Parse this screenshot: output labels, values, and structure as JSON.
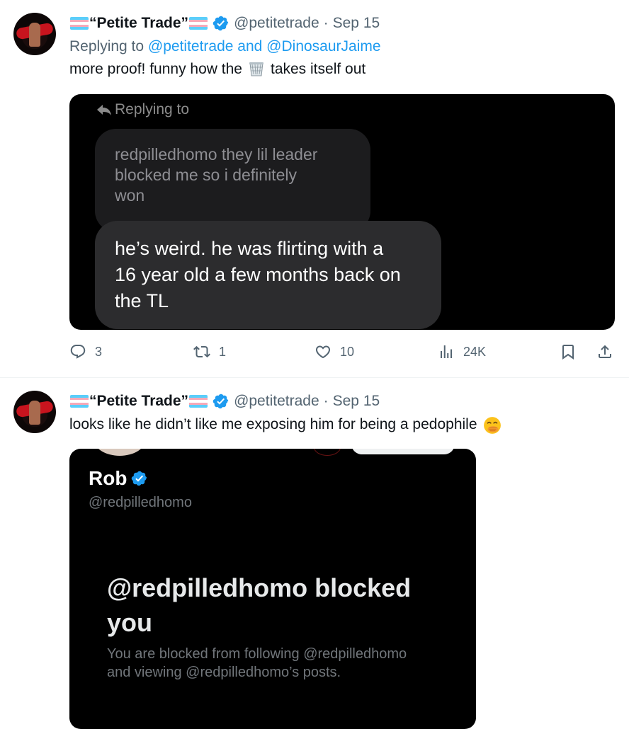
{
  "tweets": [
    {
      "author_name": "“Petite Trade”",
      "handle": "@petitetrade",
      "separator": "·",
      "date": "Sep 15",
      "replying_prefix": "Replying to",
      "replying_handles": "@petitetrade and @DinosaurJaime",
      "text_before": "more proof! funny how the",
      "text_emoji": "wastebasket-icon",
      "text_after": "takes itself out",
      "card": {
        "replying_to": "Replying to",
        "quoted_message": [
          "redpilledhomo they lil leader",
          "blocked me so i definitely",
          "won"
        ],
        "message": [
          "he’s weird. he was flirting with a",
          "16 year old a few months back on",
          "the TL"
        ]
      },
      "stats": {
        "replies": "3",
        "reposts": "1",
        "likes": "10",
        "views": "24K"
      }
    },
    {
      "author_name": "“Petite Trade”",
      "handle": "@petitetrade",
      "separator": "·",
      "date": "Sep 15",
      "text": "looks like he didn’t like me exposing him for being a pedophile",
      "text_emoji": "face-with-hand-over-mouth-icon",
      "card": {
        "profile_name": "Rob",
        "profile_handle": "@redpilledhomo",
        "blocked_title_line1": "@redpilledhomo blocked",
        "blocked_title_line2": "you",
        "blocked_desc_line1": "You are blocked from following @redpilledhomo",
        "blocked_desc_line2": "and viewing @redpilledhomo’s posts."
      }
    }
  ],
  "colors": {
    "link": "#1d9bf0",
    "secondary_text": "#536471",
    "verified": "#1d9bf0",
    "flag_blue": "#5bcefa",
    "flag_pink": "#f5a9b8"
  }
}
